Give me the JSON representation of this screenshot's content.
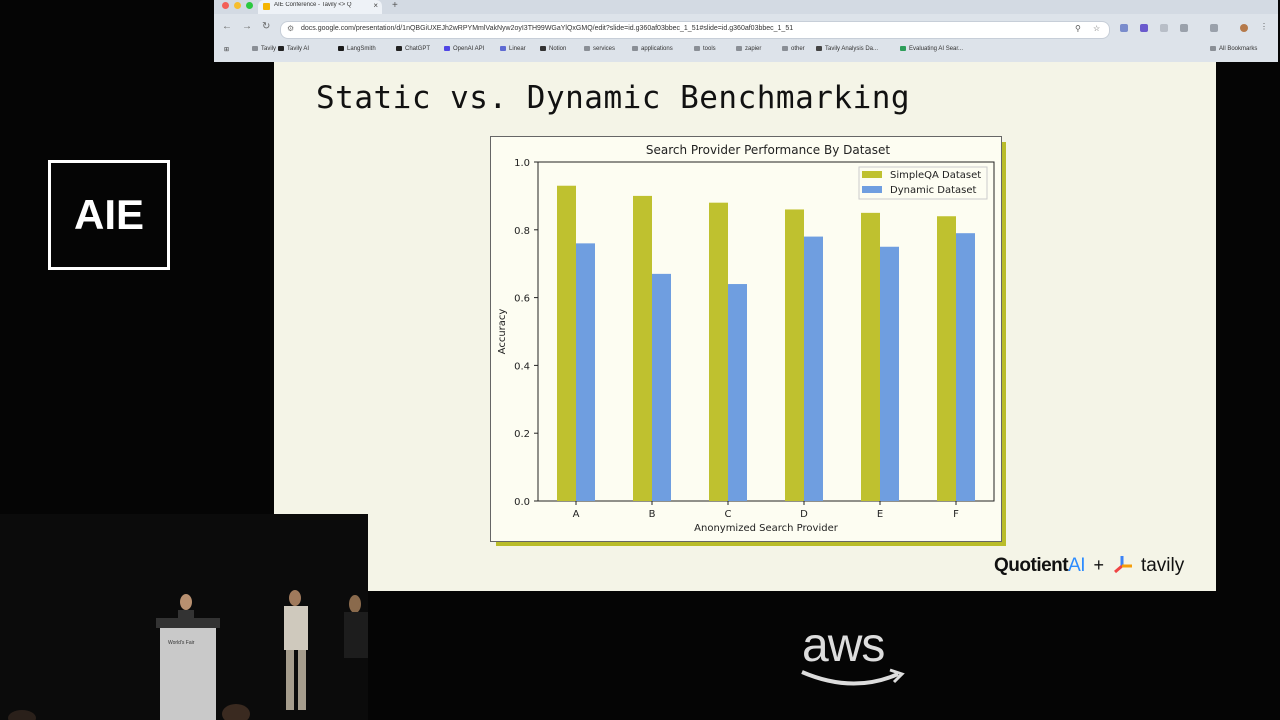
{
  "venue": {
    "logo_text": "AIE",
    "sponsor_logo": "aws",
    "podium_text": "World's Fair"
  },
  "browser": {
    "tab_title": "AIE Conference - Tavily <> Q",
    "url": "docs.google.com/presentation/d/1nQBGiUXEJh2wRPYMmlVakNyw2oyI3TH99WGaYlQxGMQ/edit?slide=id.g360af03bbec_1_51#slide=id.g360af03bbec_1_51",
    "bookmarks": [
      {
        "label": "Tavily",
        "icon": "folder-icon"
      },
      {
        "label": "Tavily AI",
        "icon": "tavily-icon"
      },
      {
        "label": "LangSmith",
        "icon": "langsmith-icon"
      },
      {
        "label": "ChatGPT",
        "icon": "chatgpt-icon"
      },
      {
        "label": "OpenAI API",
        "icon": "openai-icon"
      },
      {
        "label": "Linear",
        "icon": "linear-icon"
      },
      {
        "label": "Notion",
        "icon": "notion-icon"
      },
      {
        "label": "services",
        "icon": "folder-icon"
      },
      {
        "label": "applications",
        "icon": "folder-icon"
      },
      {
        "label": "tools",
        "icon": "folder-icon"
      },
      {
        "label": "zapier",
        "icon": "folder-icon"
      },
      {
        "label": "other",
        "icon": "folder-icon"
      },
      {
        "label": "Tavily Analysis Da...",
        "icon": "doc-icon"
      },
      {
        "label": "Evaluating AI Sear...",
        "icon": "sheets-icon"
      }
    ],
    "all_bookmarks": "All Bookmarks"
  },
  "slide": {
    "title": "Static vs. Dynamic Benchmarking",
    "logo_quotient": "Quotient",
    "logo_ai": "AI",
    "logo_plus": "+",
    "logo_tavily": "tavily"
  },
  "chart_data": {
    "type": "bar",
    "title": "Search Provider Performance By Dataset",
    "xlabel": "Anonymized Search Provider",
    "ylabel": "Accuracy",
    "categories": [
      "A",
      "B",
      "C",
      "D",
      "E",
      "F"
    ],
    "series": [
      {
        "name": "SimpleQA Dataset",
        "color": "#bfc12f",
        "values": [
          0.93,
          0.9,
          0.88,
          0.86,
          0.85,
          0.84
        ]
      },
      {
        "name": "Dynamic Dataset",
        "color": "#6f9ee0",
        "values": [
          0.76,
          0.67,
          0.64,
          0.78,
          0.75,
          0.79
        ]
      }
    ],
    "ylim": [
      0,
      1.0
    ],
    "yticks": [
      "0.0",
      "0.2",
      "0.4",
      "0.6",
      "0.8",
      "1.0"
    ],
    "legend_position": "top-right",
    "grid": false
  },
  "colors": {
    "slide_bg": "#f4f4e7",
    "chart_shadow": "#b9bc2a",
    "simpleqa": "#bfc12f",
    "dynamic": "#6f9ee0"
  }
}
